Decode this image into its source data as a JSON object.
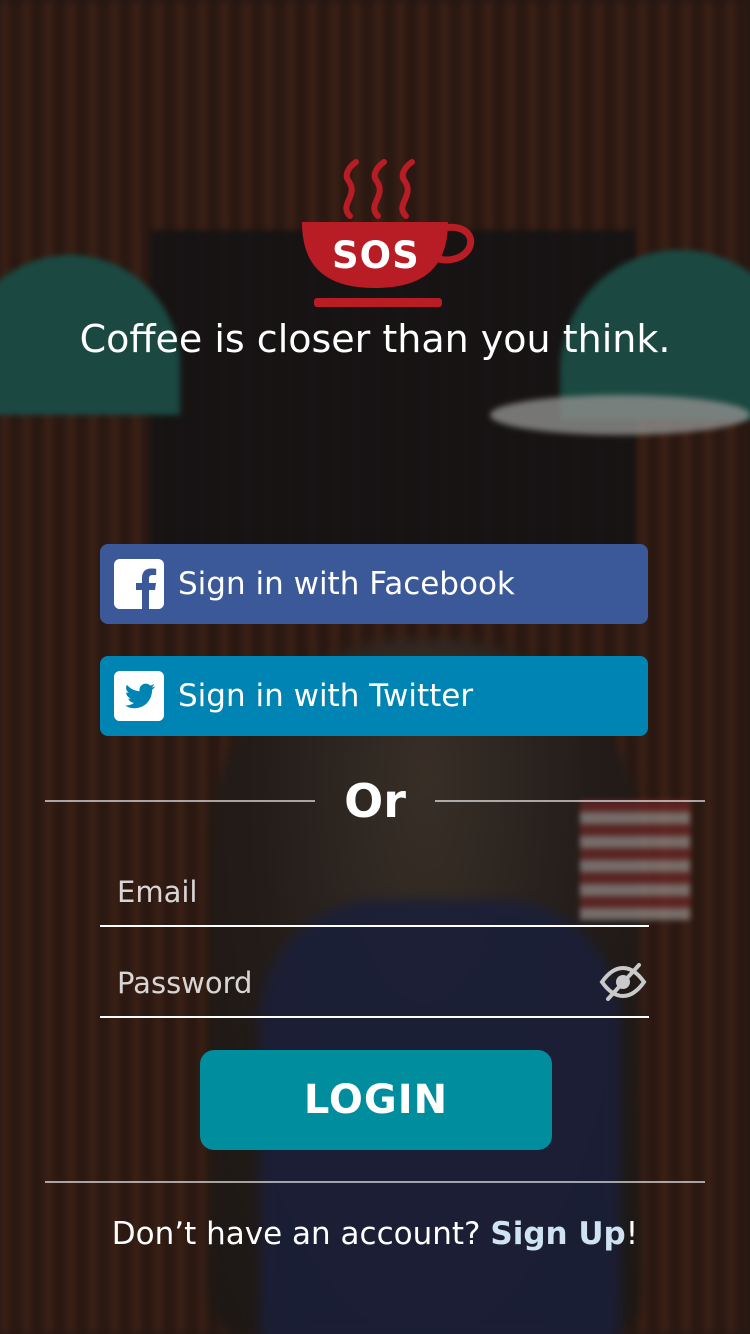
{
  "brand": {
    "logo_text": "SOS",
    "tagline": "Coffee is closer than you think.",
    "logo_color": "#b81c25"
  },
  "social": {
    "facebook_label": "Sign in with Facebook",
    "facebook_color": "#3b5998",
    "twitter_label": "Sign in with Twitter",
    "twitter_color": "#0084b4"
  },
  "divider": {
    "or_label": "Or"
  },
  "form": {
    "email_placeholder": "Email",
    "password_placeholder": "Password",
    "password_toggle_icon": "eye-slash-icon",
    "login_label": "LOGIN",
    "login_color": "#008d9e"
  },
  "footer": {
    "prompt": "Don’t have an account? ",
    "signup_link": "Sign Up",
    "suffix": "!"
  }
}
